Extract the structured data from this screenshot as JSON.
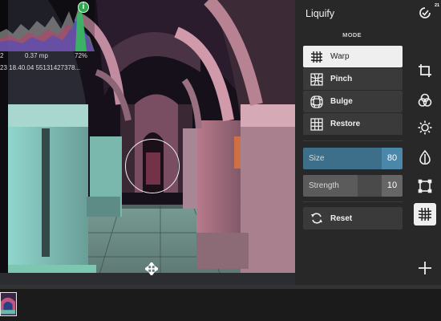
{
  "panel": {
    "title": "Liquify",
    "mode_label": "MODE",
    "modes": [
      {
        "label": "Warp",
        "icon": "grid-icon",
        "active": true
      },
      {
        "label": "Pinch",
        "icon": "pinch-icon",
        "active": false
      },
      {
        "label": "Bulge",
        "icon": "bulge-icon",
        "active": false
      },
      {
        "label": "Restore",
        "icon": "restore-icon",
        "active": false
      }
    ],
    "size": {
      "label": "Size",
      "value": "80",
      "level": 0.8
    },
    "strength": {
      "label": "Strength",
      "value": "10",
      "level": 0.55
    },
    "reset_label": "Reset"
  },
  "histogram": {
    "resolution": "0.37 mp",
    "zoom": "72%",
    "left_value": "2",
    "meta": "23 18.40.04 55131427378..."
  },
  "toolbar": {
    "history_count": "21",
    "tools": [
      "history-icon",
      "crop-icon",
      "adjust-icon",
      "light-icon",
      "color-icon",
      "frame-icon",
      "liquify-icon",
      "add-icon"
    ]
  },
  "colors": {
    "accent": "#4a87a9",
    "panel_bg": "#282828",
    "button_bg": "#3a3a3a",
    "active_bg": "#efefef"
  }
}
